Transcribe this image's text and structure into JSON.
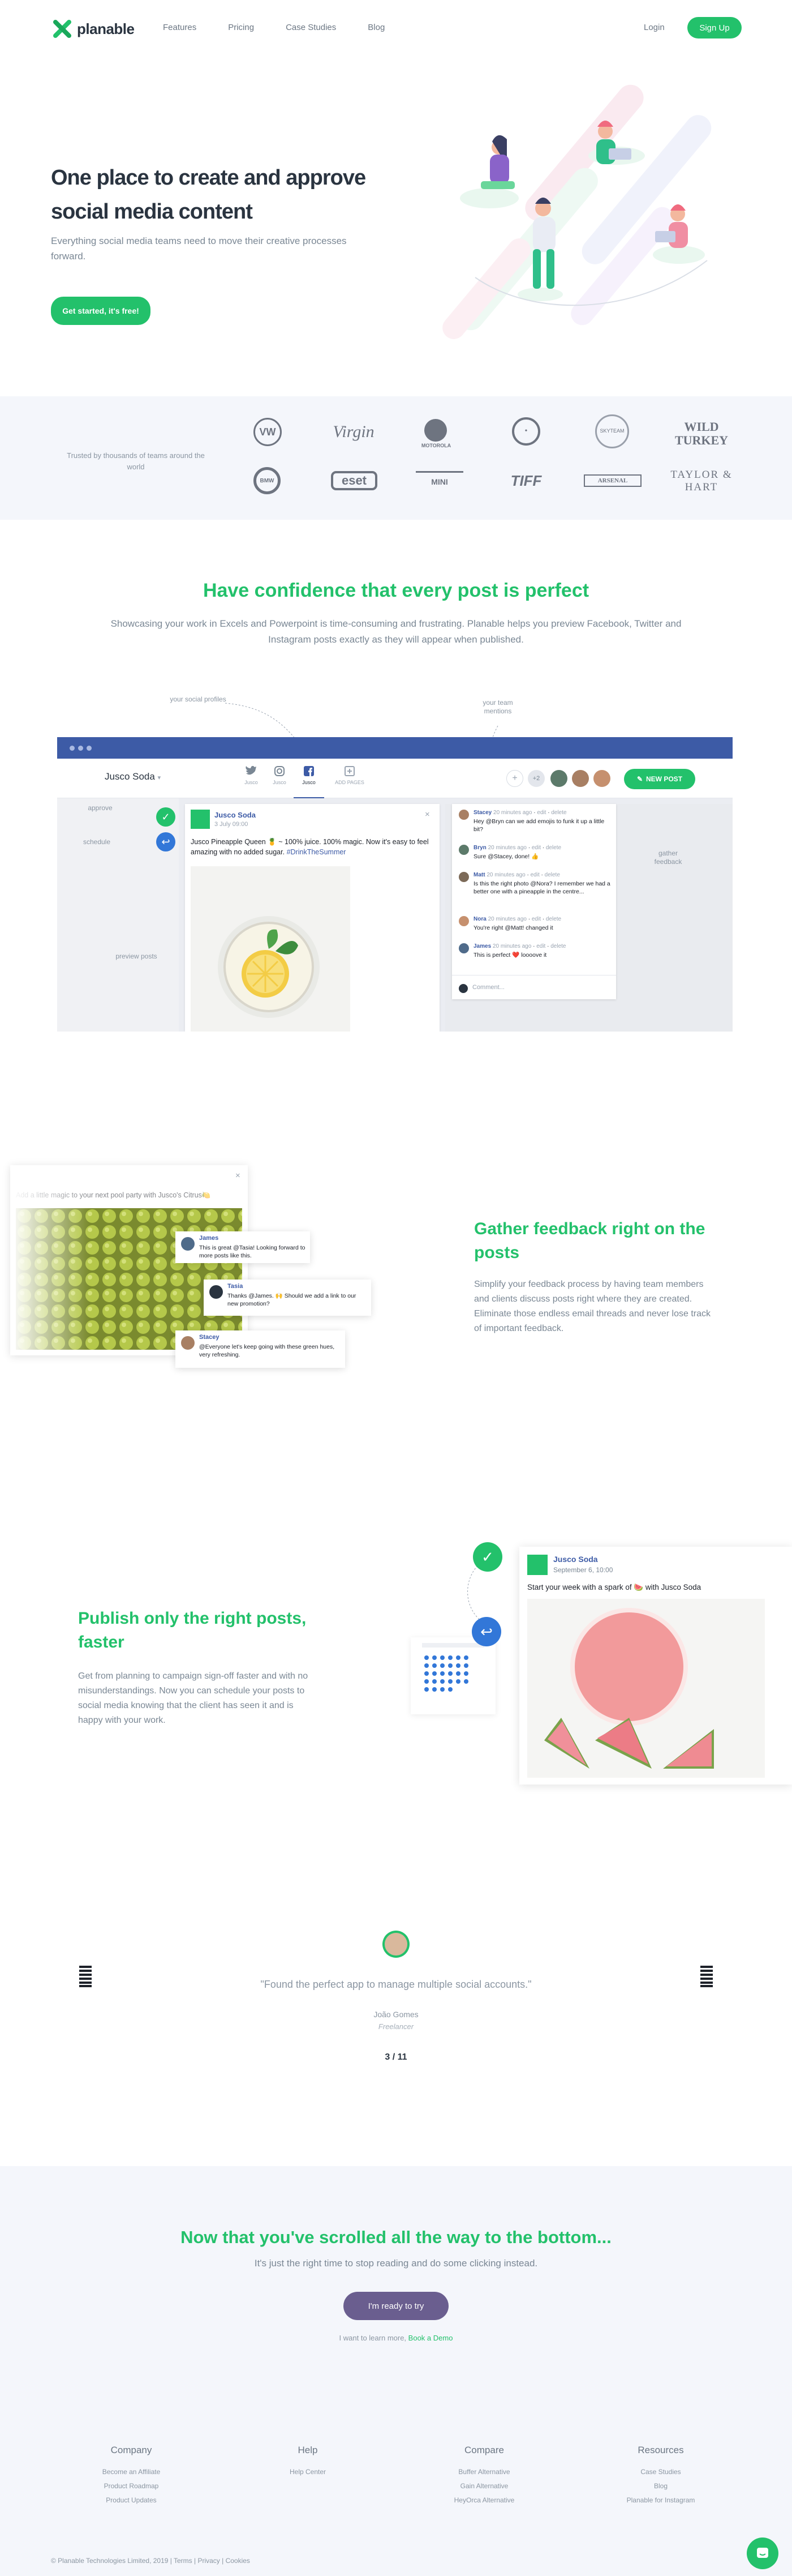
{
  "nav": {
    "brand": "planable",
    "links": [
      "Features",
      "Pricing",
      "Case Studies",
      "Blog"
    ],
    "login": "Login",
    "signup": "Sign Up"
  },
  "hero": {
    "title": "One place to create and approve social media content",
    "subtitle": "Everything social media teams need to move their creative processes forward.",
    "cta": "Get started, it's free!"
  },
  "trusted": {
    "label": "Trusted by thousands of teams around the world",
    "logos": [
      "VW",
      "Virgin",
      "MOTOROLA",
      "•",
      "SKYTEAM",
      "WILD TURKEY",
      "BMW",
      "eset",
      "MINI",
      "TIFF",
      "ARSENAL",
      "TAYLOR & HART"
    ]
  },
  "confidence": {
    "title": "Have confidence that every post is perfect",
    "subtitle": "Showcasing your work in Excels and Powerpoint is time-consuming and frustrating. Planable helps you preview Facebook, Twitter and Instagram posts exactly as they will appear when published."
  },
  "app_demo": {
    "workspace": "Jusco Soda",
    "tabs": [
      "Jusco",
      "Jusco",
      "Jusco",
      "ADD PAGES"
    ],
    "new_post": "NEW POST",
    "avatar_more": "+2",
    "annotations": {
      "profiles": "your social profiles",
      "mentions": "your team mentions",
      "approve": "approve",
      "schedule": "schedule",
      "preview": "preview posts",
      "feedback": "gather feedback"
    },
    "post": {
      "author": "Jusco Soda",
      "date": "3 July 09:00",
      "text": "Jusco Pineapple Queen 🍍 ~ 100% juice. 100% magic. Now it's easy to feel amazing with no added sugar.",
      "hashtag": "#DrinkTheSummer"
    },
    "comments": [
      {
        "name": "Stacey",
        "time": "20 minutes ago",
        "text": "Hey @Bryn can we add emojis to funk it up a little bit?"
      },
      {
        "name": "Bryn",
        "time": "20 minutes ago",
        "text": "Sure @Stacey, done! 👍"
      },
      {
        "name": "Matt",
        "time": "20 minutes ago",
        "text": "Is this the right photo @Nora? I remember we had a better one with a pineapple in the centre..."
      },
      {
        "name": "Nora",
        "time": "20 minutes ago",
        "text": "You're right @Matt! changed it"
      },
      {
        "name": "James",
        "time": "20 minutes ago",
        "text": "This is perfect ❤️ loooove it"
      }
    ],
    "comment_actions": [
      "edit",
      "delete"
    ],
    "comment_placeholder": "Comment..."
  },
  "gather": {
    "title": "Gather feedback right on the posts",
    "subtitle": "Simplify your feedback process by having team members and clients discuss posts right where they are created. Eliminate those endless email threads and never lose track of important feedback.",
    "post_text": "Add a little magic to your next pool party with Jusco's Citrus🍋",
    "comments": [
      {
        "name": "James",
        "text": "This is great @Tasia! Looking forward to more posts like this."
      },
      {
        "name": "Tasia",
        "text": "Thanks @James. 🙌 Should we add a link to our new promotion?"
      },
      {
        "name": "Stacey",
        "text": "@Everyone let's keep going with these green hues, very refreshing."
      }
    ]
  },
  "publish": {
    "title": "Publish only the right posts, faster",
    "subtitle": "Get from planning to campaign sign-off faster and with no misunderstandings. Now you can schedule your posts to social media knowing that the client has seen it and is happy with your work.",
    "post_author": "Jusco Soda",
    "post_date": "September 6, 10:00",
    "post_text": "Start your week with a spark of 🍉 with Jusco Soda"
  },
  "testimonial": {
    "quote": "\"Found the perfect app to manage multiple social accounts.\"",
    "name": "João Gomes",
    "role": "Freelancer",
    "page": "3 / 11"
  },
  "bottom_cta": {
    "title": "Now that you've scrolled all the way to the bottom...",
    "subtitle": "It's just the right time to stop reading and do some clicking instead.",
    "button": "I'm ready to try",
    "demo_prefix": "I want to learn more,",
    "demo_link": "Book a Demo"
  },
  "footer": {
    "columns": [
      {
        "title": "Company",
        "links": [
          "Become an Affiliate",
          "Product Roadmap",
          "Product Updates"
        ]
      },
      {
        "title": "Help",
        "links": [
          "Help Center"
        ]
      },
      {
        "title": "Compare",
        "links": [
          "Buffer Alternative",
          "Gain Alternative",
          "HeyOrca Alternative"
        ]
      },
      {
        "title": "Resources",
        "links": [
          "Case Studies",
          "Blog",
          "Planable for Instagram"
        ]
      }
    ],
    "copyright": "© Planable Technologies Limited, 2019 | Terms | Privacy | Cookies"
  },
  "colors": {
    "brand_green": "#23c16b",
    "app_blue": "#3d5ba6",
    "cta_purple": "#6a5e8f"
  }
}
